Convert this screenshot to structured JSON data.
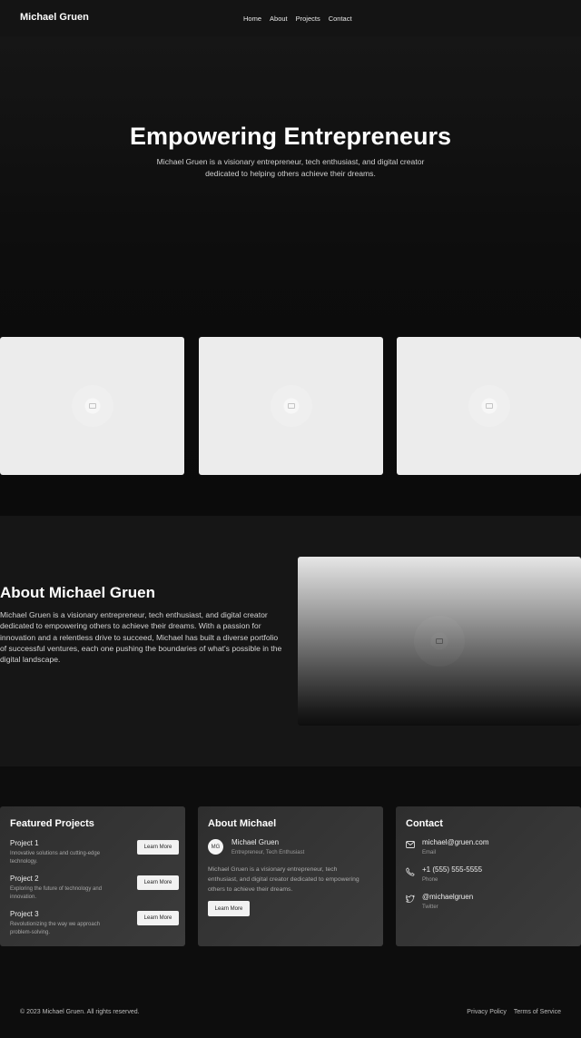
{
  "nav": {
    "brand": "Michael Gruen",
    "links": [
      "Home",
      "About",
      "Projects",
      "Contact"
    ]
  },
  "hero": {
    "title": "Empowering Entrepreneurs",
    "subtitle": "Michael Gruen is a visionary entrepreneur, tech enthusiast, and digital creator dedicated to helping others achieve their dreams."
  },
  "gallery": [
    {
      "icon": "image-placeholder-icon"
    },
    {
      "icon": "image-placeholder-icon"
    },
    {
      "icon": "image-placeholder-icon"
    }
  ],
  "about": {
    "title": "About Michael Gruen",
    "text": "Michael Gruen is a visionary entrepreneur, tech enthusiast, and digital creator dedicated to empowering others to achieve their dreams. With a passion for innovation and a relentless drive to succeed, Michael has built a diverse portfolio of successful ventures, each one pushing the boundaries of what's possible in the digital landscape."
  },
  "featured": {
    "title": "Featured Projects",
    "projects": [
      {
        "name": "Project 1",
        "desc": "Innovative solutions and cutting-edge technology.",
        "button": "Learn More"
      },
      {
        "name": "Project 2",
        "desc": "Exploring the future of technology and innovation.",
        "button": "Learn More"
      },
      {
        "name": "Project 3",
        "desc": "Revolutionizing the way we approach problem-solving.",
        "button": "Learn More"
      }
    ]
  },
  "profile": {
    "title": "About Michael",
    "initials": "MG",
    "name": "Michael Gruen",
    "role": "Entrepreneur, Tech Enthusiast",
    "bio": "Michael Gruen is a visionary entrepreneur, tech enthusiast, and digital creator dedicated to empowering others to achieve their dreams.",
    "button": "Learn More"
  },
  "contact": {
    "title": "Contact",
    "items": [
      {
        "icon": "mail-icon",
        "value": "michael@gruen.com",
        "label": "Email"
      },
      {
        "icon": "phone-icon",
        "value": "+1 (555) 555-5555",
        "label": "Phone"
      },
      {
        "icon": "twitter-icon",
        "value": "@michaelgruen",
        "label": "Twitter"
      }
    ]
  },
  "footer": {
    "copyright": "© 2023 Michael Gruen. All rights reserved.",
    "links": [
      "Privacy Policy",
      "Terms of Service"
    ]
  },
  "colors": {
    "background": "#0c0c0c",
    "panel": "#353535",
    "card": "#ececec",
    "button": "#f2f2f2"
  }
}
